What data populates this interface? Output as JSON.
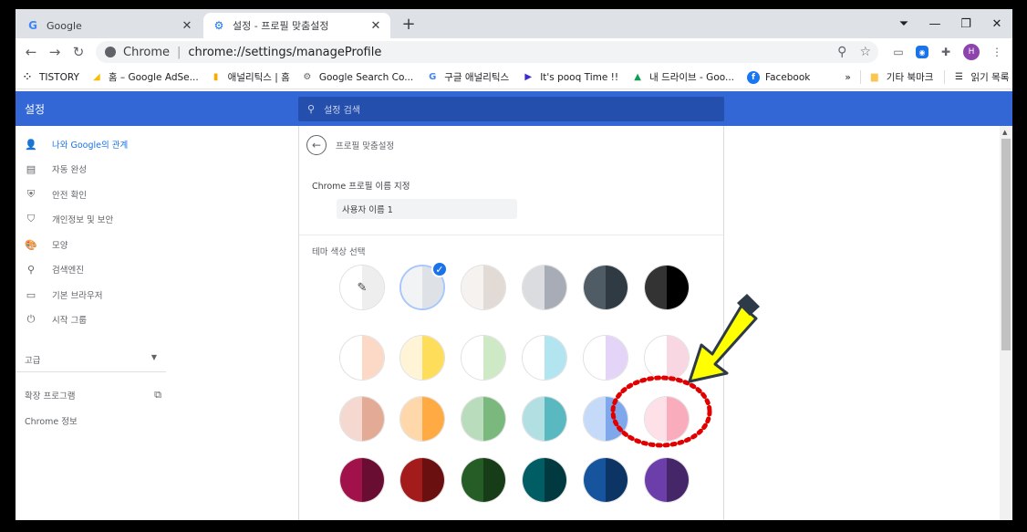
{
  "tabs": [
    {
      "title": "Google",
      "icon": "google-favicon"
    },
    {
      "title": "설정 - 프로필 맞춤설정",
      "icon": "gear-icon"
    }
  ],
  "toolbar": {
    "site_chip": "Chrome",
    "url": "chrome://settings/manageProfile",
    "avatar_letter": "H"
  },
  "bookmarks": [
    {
      "label": "TISTORY",
      "icon": "tistory-icon"
    },
    {
      "label": "홈 – Google AdSe...",
      "icon": "adsense-icon"
    },
    {
      "label": "애널리틱스 | 홈",
      "icon": "analytics-icon"
    },
    {
      "label": "Google Search Co...",
      "icon": "search-console-icon"
    },
    {
      "label": "구글 애널리틱스",
      "icon": "google-favicon"
    },
    {
      "label": "It's pooq Time !!",
      "icon": "pooq-icon"
    },
    {
      "label": "내 드라이브 - Goo...",
      "icon": "drive-icon"
    },
    {
      "label": "Facebook",
      "icon": "facebook-icon"
    }
  ],
  "bookmarks_overflow": "»",
  "bookmarks_other": "기타 북마크",
  "bookmarks_reading": "읽기 목록",
  "settings": {
    "title": "설정",
    "search_placeholder": "설정 검색"
  },
  "sidebar": {
    "items": [
      {
        "label": "나와 Google의 관계",
        "icon": "person-icon",
        "active": true
      },
      {
        "label": "자동 완성",
        "icon": "clipboard-icon",
        "active": false
      },
      {
        "label": "안전 확인",
        "icon": "shield-check-icon",
        "active": false
      },
      {
        "label": "개인정보 및 보안",
        "icon": "shield-half-icon",
        "active": false
      },
      {
        "label": "모양",
        "icon": "palette-icon",
        "active": false
      },
      {
        "label": "검색엔진",
        "icon": "search-icon",
        "active": false
      },
      {
        "label": "기본 브라우저",
        "icon": "browser-icon",
        "active": false
      },
      {
        "label": "시작 그룹",
        "icon": "power-icon",
        "active": false
      }
    ],
    "advanced": "고급",
    "extensions": "확장 프로그램",
    "about": "Chrome 정보"
  },
  "main": {
    "page_title": "프로필 맞춤설정",
    "name_label": "Chrome 프로필 이름 지정",
    "name_value": "사용자 이름 1",
    "theme_label": "테마 색상 선택"
  },
  "themes": [
    [
      {
        "left": "#ffffff",
        "right": "#eeeeee",
        "kind": "custom"
      },
      {
        "left": "#f1f3f4",
        "right": "#dee1e6",
        "kind": "selected"
      },
      {
        "left": "#f5f2ef",
        "right": "#e2dad5"
      },
      {
        "left": "#dadce0",
        "right": "#a8acb7"
      },
      {
        "left": "#4f5c66",
        "right": "#2f3a42"
      },
      {
        "left": "#333333",
        "right": "#000000"
      }
    ],
    [
      {
        "left": "#ffffff",
        "right": "#fbd9c6"
      },
      {
        "left": "#fff5d6",
        "right": "#fedd5b"
      },
      {
        "left": "#ffffff",
        "right": "#cde9c6"
      },
      {
        "left": "#ffffff",
        "right": "#b2e5ef"
      },
      {
        "left": "#ffffff",
        "right": "#e4d4f8"
      },
      {
        "left": "#ffffff",
        "right": "#f8d7e3"
      }
    ],
    [
      {
        "left": "#f5d8cf",
        "right": "#e3aa96"
      },
      {
        "left": "#fed8ab",
        "right": "#ffaa42"
      },
      {
        "left": "#b9dcbd",
        "right": "#7bb87e"
      },
      {
        "left": "#b2dfe2",
        "right": "#5ab8c0"
      },
      {
        "left": "#c5d9f8",
        "right": "#7ea7ec"
      },
      {
        "left": "#fde0e8",
        "right": "#f9acbb"
      }
    ],
    [
      {
        "left": "#a1124b",
        "right": "#6a0d33"
      },
      {
        "left": "#a31b1b",
        "right": "#6b1010"
      },
      {
        "left": "#265c25",
        "right": "#173d18"
      },
      {
        "left": "#005d64",
        "right": "#003a40"
      },
      {
        "left": "#16559e",
        "right": "#0c3464"
      },
      {
        "left": "#6c3eaa",
        "right": "#452669"
      }
    ]
  ],
  "colors": {
    "accent": "#3367d6",
    "search_bg": "#254fad",
    "annotation_circle": "#e00000",
    "arrow_fill": "#ffff00",
    "arrow_stroke": "#2d3a48"
  }
}
